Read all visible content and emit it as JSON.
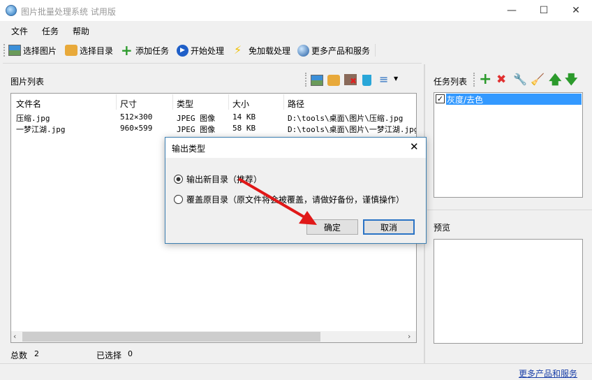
{
  "window": {
    "title": "图片批量处理系统 试用版",
    "minimize": "—",
    "maximize": "☐",
    "close": "✕"
  },
  "menu": [
    "文件",
    "任务",
    "帮助"
  ],
  "toolbar": [
    "选择图片",
    "选择目录",
    "添加任务",
    "开始处理",
    "免加载处理",
    "更多产品和服务"
  ],
  "image_list": {
    "title": "图片列表",
    "columns": [
      "文件名",
      "尺寸",
      "类型",
      "大小",
      "路径"
    ],
    "rows": [
      [
        "压缩.jpg",
        "512×300",
        "JPEG 图像",
        "14 KB",
        "D:\\tools\\桌面\\图片\\压缩.jpg"
      ],
      [
        "一梦江湖.jpg",
        "960×599",
        "JPEG 图像",
        "58 KB",
        "D:\\tools\\桌面\\图片\\一梦江湖.jpg"
      ]
    ]
  },
  "status": {
    "total_label": "总数",
    "total": "2",
    "selected_label": "已选择",
    "selected": "0"
  },
  "task_list": {
    "title": "任务列表",
    "items": [
      {
        "label": "灰度/去色",
        "checked": true
      }
    ]
  },
  "preview": {
    "title": "预览"
  },
  "footer_link": "更多产品和服务",
  "dialog": {
    "title": "输出类型",
    "close": "✕",
    "options": [
      {
        "label": "输出新目录（推荐）",
        "selected": true
      },
      {
        "label": "覆盖原目录（原文件将会被覆盖，请做好备份，谨慎操作）",
        "selected": false
      }
    ],
    "ok": "确定",
    "cancel": "取消"
  }
}
